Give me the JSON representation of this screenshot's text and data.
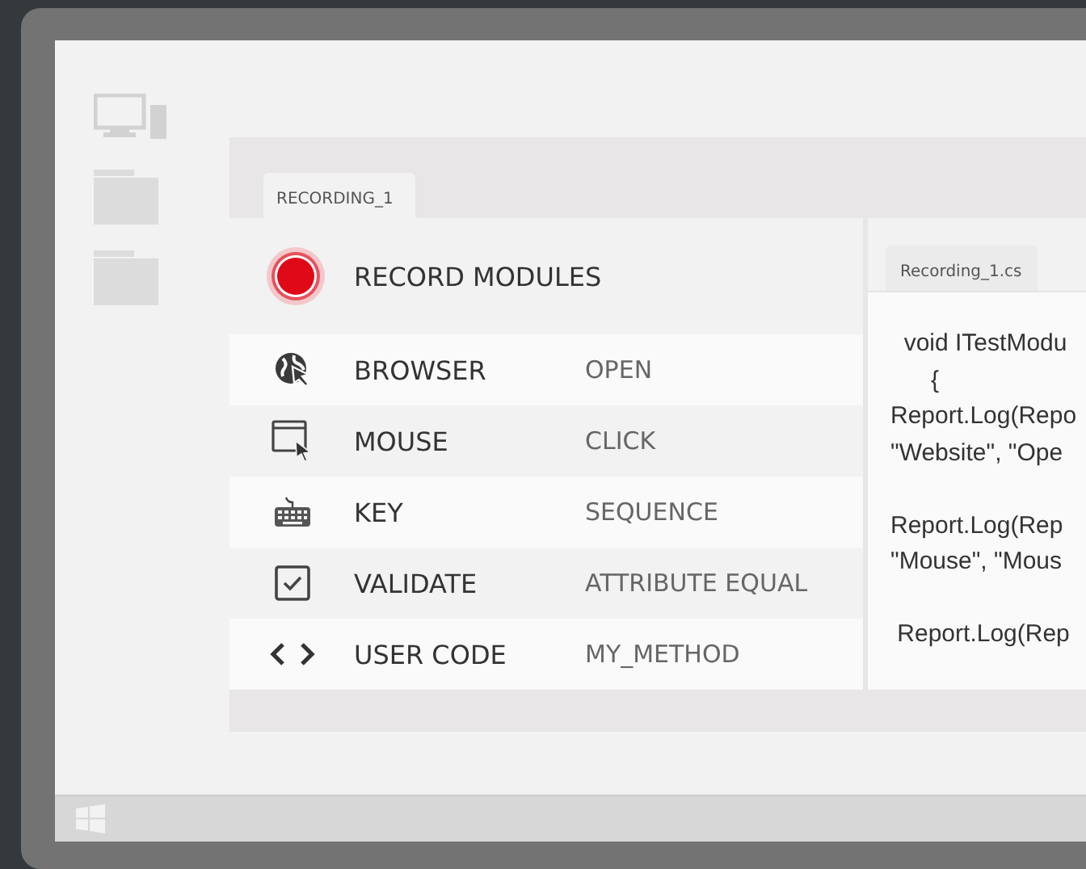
{
  "window": {
    "tab": "RECORDING_1"
  },
  "modules": {
    "title": "RECORD MODULES",
    "rows": [
      {
        "kind": "browser",
        "name": "BROWSER",
        "action": "OPEN"
      },
      {
        "kind": "mouse",
        "name": "MOUSE",
        "action": "CLICK"
      },
      {
        "kind": "key",
        "name": "KEY",
        "action": "SEQUENCE"
      },
      {
        "kind": "validate",
        "name": "VALIDATE",
        "action": "ATTRIBUTE EQUAL"
      },
      {
        "kind": "code",
        "name": "USER CODE",
        "action": "MY_METHOD"
      }
    ]
  },
  "editor": {
    "tab": "Recording_1.cs",
    "blocks": [
      {
        "lines": [
          "  void ITestModu",
          "      {",
          "Report.Log(Repo",
          "\"Website\", \"Ope"
        ]
      },
      {
        "lines": [
          "Report.Log(Rep",
          "\"Mouse\", \"Mous"
        ]
      },
      {
        "lines": [
          " Report.Log(Rep"
        ]
      }
    ]
  }
}
